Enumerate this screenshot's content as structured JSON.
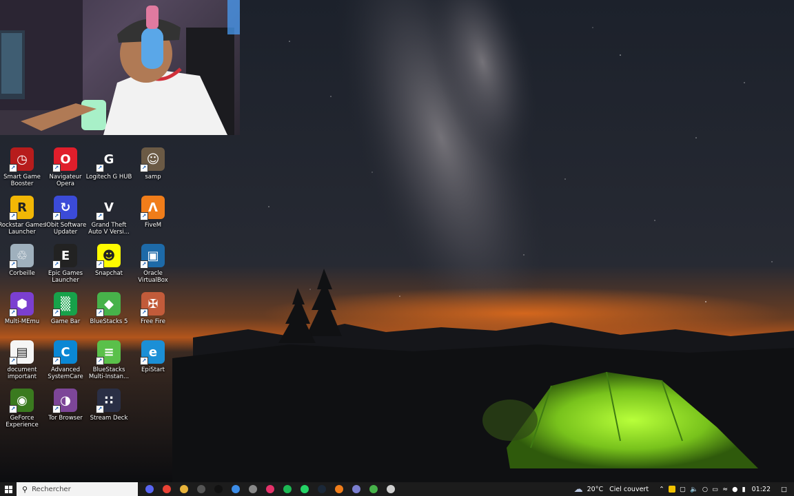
{
  "desktop_icons": [
    {
      "label": "Smart Game Booster",
      "color": "#b71c1c",
      "glyph": "◷",
      "col": 0,
      "row": 0
    },
    {
      "label": "Navigateur Opera",
      "color": "#e01e2b",
      "glyph": "O",
      "col": 1,
      "row": 0
    },
    {
      "label": "Logitech G HUB",
      "color": "transparent",
      "glyph": "G",
      "col": 2,
      "row": 0
    },
    {
      "label": "samp",
      "color": "#6b5a45",
      "glyph": "☺",
      "col": 3,
      "row": 0
    },
    {
      "label": "Rockstar Games Launcher",
      "color": "#f2b705",
      "glyph": "R",
      "col": 0,
      "row": 1
    },
    {
      "label": "IObit Software Updater",
      "color": "#3b4bd8",
      "glyph": "↻",
      "col": 1,
      "row": 1
    },
    {
      "label": "Grand Theft Auto V Versi...",
      "color": "transparent",
      "glyph": "V",
      "col": 2,
      "row": 1
    },
    {
      "label": "FiveM",
      "color": "#f07d1a",
      "glyph": "Λ",
      "col": 3,
      "row": 1
    },
    {
      "label": "Corbeille",
      "color": "#9fb0bd",
      "glyph": "♲",
      "col": 0,
      "row": 2
    },
    {
      "label": "Epic Games Launcher",
      "color": "#222",
      "glyph": "E",
      "col": 1,
      "row": 2
    },
    {
      "label": "Snapchat",
      "color": "#fffc00",
      "glyph": "☻",
      "col": 2,
      "row": 2
    },
    {
      "label": "Oracle VirtualBox",
      "color": "#1d6aa8",
      "glyph": "▣",
      "col": 3,
      "row": 2
    },
    {
      "label": "Multi-MEmu",
      "color": "#7b3fd0",
      "glyph": "⬢",
      "col": 0,
      "row": 3
    },
    {
      "label": "Game Bar",
      "color": "#17a24a",
      "glyph": "▒",
      "col": 1,
      "row": 3
    },
    {
      "label": "BlueStacks 5",
      "color": "#47b24a",
      "glyph": "◆",
      "col": 2,
      "row": 3
    },
    {
      "label": "Free Fire",
      "color": "#c25b3a",
      "glyph": "✠",
      "col": 3,
      "row": 3
    },
    {
      "label": "document important",
      "color": "#f5f5f5",
      "glyph": "▤",
      "col": 0,
      "row": 4
    },
    {
      "label": "Advanced SystemCare",
      "color": "#0a87d4",
      "glyph": "C",
      "col": 1,
      "row": 4
    },
    {
      "label": "BlueStacks Multi-Instan...",
      "color": "#5ac04a",
      "glyph": "≡",
      "col": 2,
      "row": 4
    },
    {
      "label": "EpiStart",
      "color": "#1b8fd6",
      "glyph": "e",
      "col": 3,
      "row": 4
    },
    {
      "label": "GeForce Experience",
      "color": "#3a7a1f",
      "glyph": "◉",
      "col": 0,
      "row": 5
    },
    {
      "label": "Tor Browser",
      "color": "#7d4698",
      "glyph": "◑",
      "col": 1,
      "row": 5
    },
    {
      "label": "Stream Deck",
      "color": "#2a2f45",
      "glyph": "∷",
      "col": 2,
      "row": 5
    }
  ],
  "taskbar": {
    "search_placeholder": "Rechercher",
    "apps": [
      {
        "name": "discord-taskbar-icon",
        "color": "#5865f2"
      },
      {
        "name": "chrome-taskbar-icon",
        "color": "#e94235"
      },
      {
        "name": "file-explorer-taskbar-icon",
        "color": "#e8b33a"
      },
      {
        "name": "obs-taskbar-icon",
        "color": "#555"
      },
      {
        "name": "tiktok-taskbar-icon",
        "color": "#111"
      },
      {
        "name": "store-taskbar-icon",
        "color": "#3c8ce7"
      },
      {
        "name": "ghub-taskbar-icon",
        "color": "#888"
      },
      {
        "name": "music-taskbar-icon",
        "color": "#e5326a"
      },
      {
        "name": "spotify-taskbar-icon",
        "color": "#1db954"
      },
      {
        "name": "whatsapp-taskbar-icon",
        "color": "#25d366"
      },
      {
        "name": "steam-taskbar-icon",
        "color": "#1b2838"
      },
      {
        "name": "fivem-taskbar-icon",
        "color": "#f07d1a"
      },
      {
        "name": "gamepad-taskbar-icon",
        "color": "#7b7fd0"
      },
      {
        "name": "bluestacks-taskbar-icon",
        "color": "#47b24a"
      },
      {
        "name": "settings-taskbar-icon",
        "color": "#cfcfcf"
      }
    ],
    "weather_temp": "20°C",
    "weather_desc": "Ciel couvert",
    "time": "01:22"
  }
}
